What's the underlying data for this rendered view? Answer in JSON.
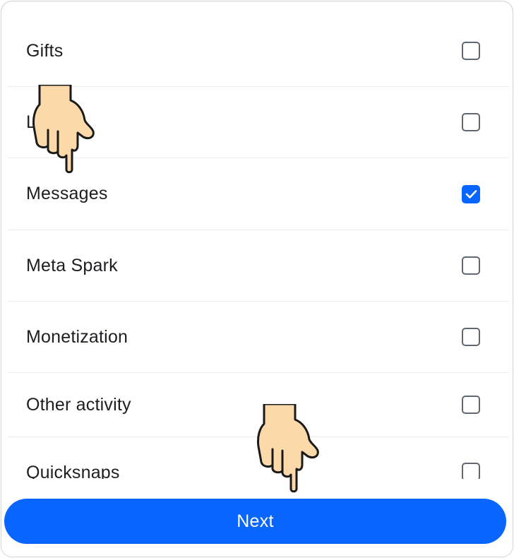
{
  "list": {
    "items": [
      {
        "label": "Gifts",
        "checked": false
      },
      {
        "label": "L",
        "checked": false
      },
      {
        "label": "Messages",
        "checked": true
      },
      {
        "label": "Meta Spark",
        "checked": false
      },
      {
        "label": "Monetization",
        "checked": false
      },
      {
        "label": "Other activity",
        "checked": false
      },
      {
        "label": "Quicksnaps",
        "checked": false
      }
    ]
  },
  "footer": {
    "next_label": "Next"
  },
  "colors": {
    "accent": "#0866ff",
    "hand_fill": "#fcd9a8"
  }
}
